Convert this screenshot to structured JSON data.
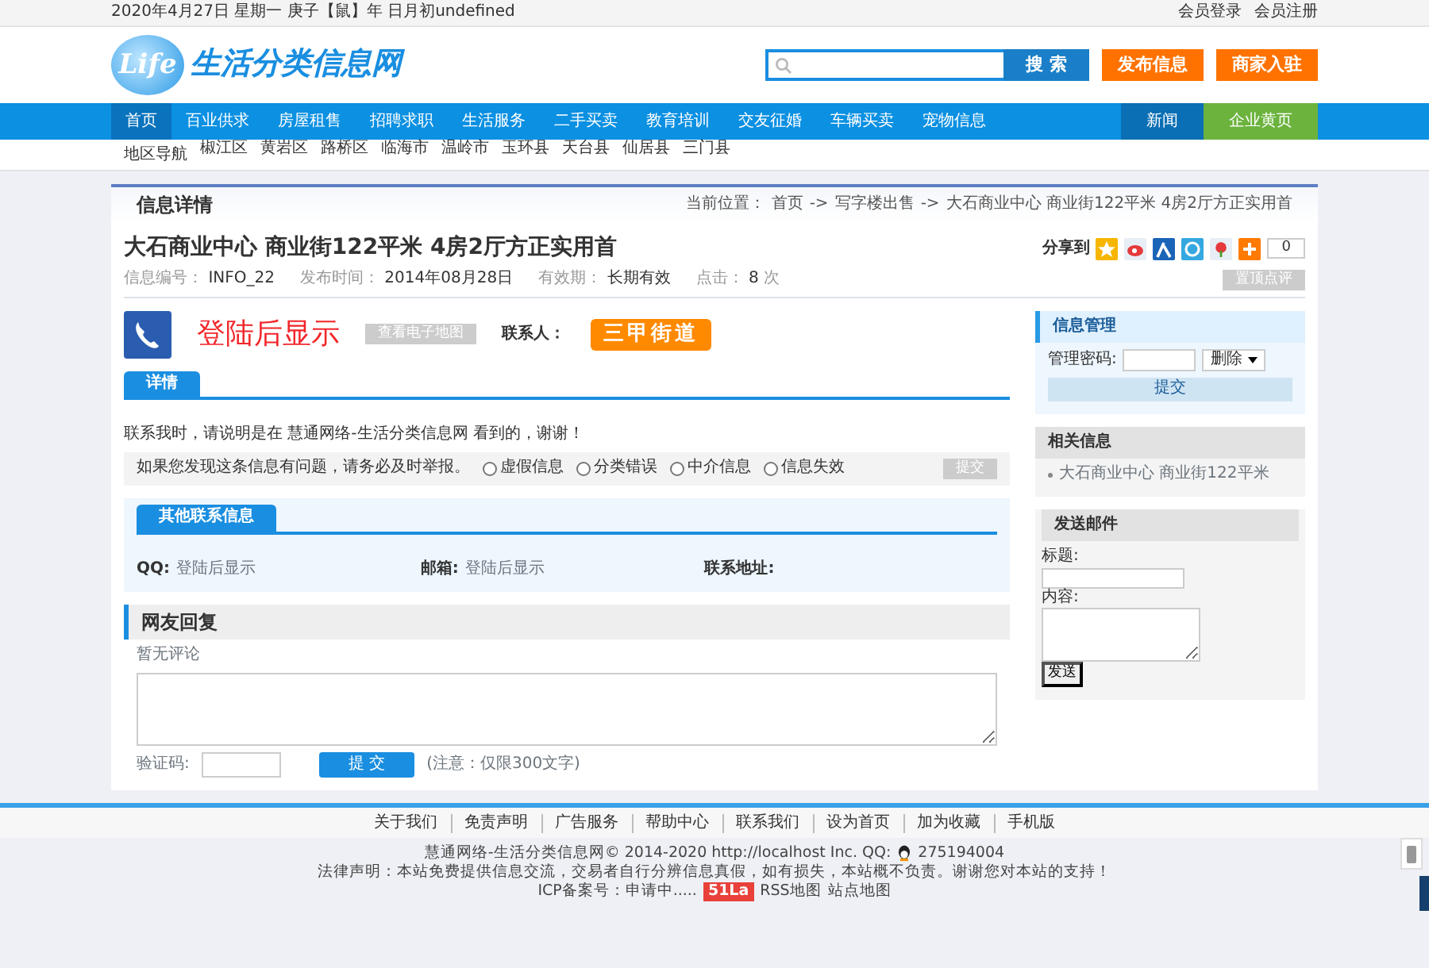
{
  "top_bar": {
    "date": "2020年4月27日 星期一  庚子【鼠】年 日月初undefined",
    "links": [
      "会员登录",
      "会员注册"
    ]
  },
  "header": {
    "logo_badge": "Life",
    "logo_text": "生活分类信息网",
    "search_button": "搜 索",
    "buttons": [
      "发布信息",
      "商家入驻"
    ]
  },
  "nav": [
    {
      "label": "首页",
      "selected": true
    },
    {
      "label": "百业供求",
      "selected": false
    },
    {
      "label": "房屋租售",
      "selected": false
    },
    {
      "label": "招聘求职",
      "selected": false
    },
    {
      "label": "生活服务",
      "selected": false
    },
    {
      "label": "二手买卖",
      "selected": false
    },
    {
      "label": "教育培训",
      "selected": false
    },
    {
      "label": "交友征婚",
      "selected": false
    },
    {
      "label": "车辆买卖",
      "selected": false
    },
    {
      "label": "宠物信息",
      "selected": false
    }
  ],
  "nav_right": [
    {
      "label": "新闻",
      "kind": "dark"
    },
    {
      "label": "企业黄页",
      "kind": "green"
    }
  ],
  "regions": {
    "label": "地区导航",
    "items": [
      "椒江区",
      "黄岩区",
      "路桥区",
      "临海市",
      "温岭市",
      "玉环县",
      "天台县",
      "仙居县",
      "三门县"
    ]
  },
  "page_title": "信息详情",
  "breadcrumb": {
    "label": "当前位置：",
    "separator": "->",
    "items": [
      "首页",
      "写字楼出售",
      "大石商业中心 商业街122平米 4房2厅方正实用首"
    ]
  },
  "post": {
    "title": "大石商业中心 商业街122平米 4房2厅方正实用首",
    "share_label": "分享到",
    "share_count": "0",
    "meta": [
      {
        "label": "信息编号：",
        "value": "INFO_22"
      },
      {
        "label": "发布时间：",
        "value": "2014年08月28日"
      },
      {
        "label": "有效期：",
        "value": "长期有效"
      },
      {
        "label": "点击：",
        "value": "8",
        "unit": "次"
      }
    ],
    "top_button": "置顶点评",
    "phone": "登陆后显示",
    "map_button": "查看电子地图",
    "contact_label": "联系人：",
    "contact_name": "三甲街道"
  },
  "tabs": [
    {
      "label": "详情",
      "selected": true
    }
  ],
  "notice": "联系我时，请说明是在 慧通网络-生活分类信息网 看到的，谢谢！",
  "report": {
    "text": "如果您发现这条信息有问题，请务必及时举报。",
    "options": [
      {
        "label": "虚假信息",
        "selected": false
      },
      {
        "label": "分类错误",
        "selected": false
      },
      {
        "label": "中介信息",
        "selected": false
      },
      {
        "label": "信息失效",
        "selected": false
      }
    ],
    "button": "提交"
  },
  "contact_box": {
    "tab": "其他联系信息",
    "fields": [
      {
        "label": "QQ:",
        "value": "登陆后显示"
      },
      {
        "label": "邮箱:",
        "value": "登陆后显示"
      },
      {
        "label": "联系地址:"
      }
    ]
  },
  "replies": {
    "title": "网友回复",
    "empty": "暂无评论",
    "captcha_label": "验证码:",
    "submit": "提 交",
    "note": "(注意：仅限300文字)"
  },
  "sidebar": {
    "manage": {
      "title": "信息管理",
      "label": "管理密码:",
      "select": "删除",
      "button": "提交"
    },
    "related": {
      "title": "相关信息",
      "items": [
        "大石商业中心 商业街122平米"
      ]
    },
    "mail": {
      "title": "发送邮件",
      "subject_label": "标题:",
      "content_label": "内容:",
      "button": "发送"
    }
  },
  "footer": {
    "links": [
      "关于我们",
      "免责声明",
      "广告服务",
      "帮助中心",
      "联系我们",
      "设为首页",
      "加为收藏",
      "手机版"
    ],
    "copyright": "慧通网络-生活分类信息网© 2014-2020 http://localhost Inc. QQ:",
    "qq": "275194004",
    "disclaimer": "法律声明：本站免费提供信息交流，交易者自行分辨信息真假，如有损失，本站概不负责。谢谢您对本站的支持！",
    "icp": "ICP备案号：申请中.....",
    "badge": "51La",
    "map_links": [
      "RSS地图",
      "站点地图"
    ]
  }
}
